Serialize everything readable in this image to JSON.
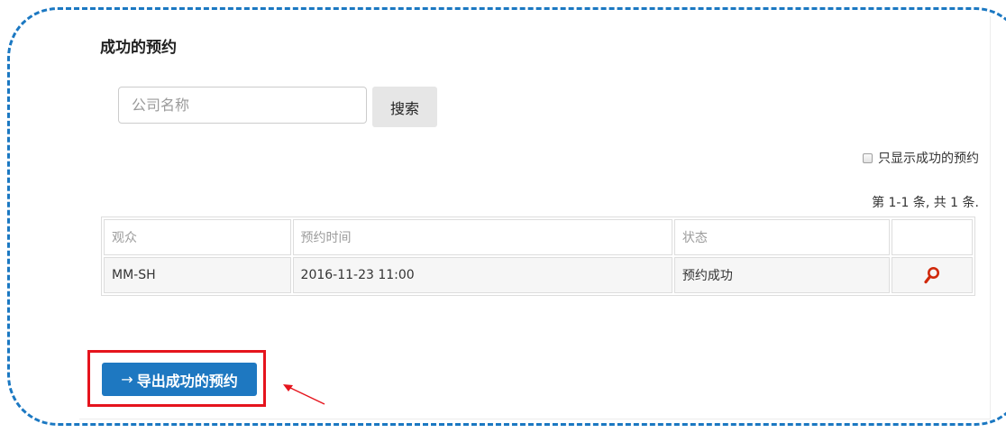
{
  "page": {
    "title": "成功的预约"
  },
  "search": {
    "placeholder": "公司名称",
    "value": "",
    "button_label": "搜索"
  },
  "filter": {
    "label": "只显示成功的预约",
    "checked": false
  },
  "summary": "第 1-1 条, 共 1 条.",
  "table": {
    "headers": [
      "观众",
      "预约时间",
      "状态",
      ""
    ],
    "rows": [
      {
        "audience": "MM-SH",
        "time": "2016-11-23 11:00",
        "status": "预约成功",
        "action_icon": "search-icon"
      }
    ]
  },
  "export": {
    "arrow": "→",
    "label": "导出成功的预约"
  },
  "colors": {
    "accent": "#1e78c1",
    "frame": "#1b78c2",
    "highlight": "#e5141d",
    "icon": "#d0290b"
  }
}
